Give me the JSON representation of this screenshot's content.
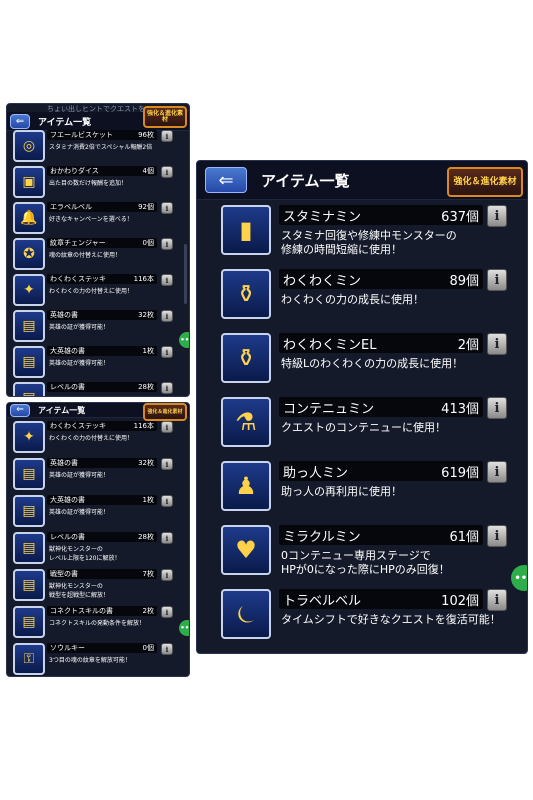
{
  "header": {
    "title": "アイテム一覧",
    "badge": "強化＆進化素材",
    "back_icon": "back-arrow-icon"
  },
  "top_left_overlay": "ちょい出しヒントでクエストを",
  "panel_a": {
    "items": [
      {
        "name": "フエールビスケット",
        "count": "96枚",
        "desc": "スタミナ消費2倍でスペシャル報酬2倍",
        "icon": "biscuit-icon"
      },
      {
        "name": "おかわりダイス",
        "count": "4個",
        "desc": "出た目の数だけ報酬を追加！",
        "icon": "dice-icon"
      },
      {
        "name": "エラベルベル",
        "count": "92個",
        "desc": "好きなキャンペーンを選べる！",
        "icon": "bell-icon"
      },
      {
        "name": "紋章チェンジャー",
        "count": "0個",
        "desc": "魂の紋章の付替えに使用！",
        "icon": "emblem-icon"
      },
      {
        "name": "わくわくステッキ",
        "count": "116本",
        "desc": "わくわくの力の付替えに使用！",
        "icon": "stick-icon"
      },
      {
        "name": "英雄の書",
        "count": "32枚",
        "desc": "英雄の証が獲得可能！",
        "icon": "book-icon"
      },
      {
        "name": "大英雄の書",
        "count": "1枚",
        "desc": "英雄の証が獲得可能！",
        "icon": "book-icon"
      },
      {
        "name": "レベルの書",
        "count": "28枚",
        "desc": "",
        "icon": "book-icon"
      }
    ]
  },
  "panel_b": {
    "items": [
      {
        "name": "わくわくステッキ",
        "count": "116本",
        "desc": "わくわくの力の付替えに使用！",
        "icon": "stick-icon"
      },
      {
        "name": "英雄の書",
        "count": "32枚",
        "desc": "英雄の証が獲得可能！",
        "icon": "book-icon"
      },
      {
        "name": "大英雄の書",
        "count": "1枚",
        "desc": "英雄の証が獲得可能！",
        "icon": "book-icon"
      },
      {
        "name": "レベルの書",
        "count": "28枚",
        "desc": "獣神化モンスターの|レベル上限を120に解放！",
        "icon": "book-icon"
      },
      {
        "name": "戦型の書",
        "count": "7枚",
        "desc": "獣神化モンスターの|戦型を超戦型に解放！",
        "icon": "book-icon"
      },
      {
        "name": "コネクトスキルの書",
        "count": "2枚",
        "desc": "コネクトスキルの発動条件を解放！",
        "icon": "book-icon"
      },
      {
        "name": "ソウルキー",
        "count": "0個",
        "desc": "3つ目の魂の紋章を解放可能！",
        "icon": "key-icon"
      }
    ]
  },
  "panel_c": {
    "items": [
      {
        "name": "スタミナミン",
        "count": "637個",
        "desc": "スタミナ回復や修練中モンスターの|修練の時間短縮に使用！",
        "icon": "stamina-can-icon"
      },
      {
        "name": "わくわくミン",
        "count": "89個",
        "desc": "わくわくの力の成長に使用！",
        "icon": "bottle-icon"
      },
      {
        "name": "わくわくミンEL",
        "count": "2個",
        "desc": "特級Lのわくわくの力の成長に使用！",
        "icon": "bottle-el-icon"
      },
      {
        "name": "コンテニュミン",
        "count": "413個",
        "desc": "クエストのコンテニューに使用！",
        "icon": "continue-potion-icon"
      },
      {
        "name": "助っ人ミン",
        "count": "619個",
        "desc": "助っ人の再利用に使用！",
        "icon": "helper-icon"
      },
      {
        "name": "ミラクルミン",
        "count": "61個",
        "desc": "0コンテニュー専用ステージで|HPが0になった際にHPのみ回復！",
        "icon": "miracle-potion-icon"
      },
      {
        "name": "トラベルベル",
        "count": "102個",
        "desc": "タイムシフトで好きなクエストを復活可能！",
        "icon": "travel-bell-icon"
      }
    ]
  },
  "fab_label": "•••",
  "info_label": "i",
  "colors": {
    "accent": "#2eae4a",
    "panel_bg": "#141a2a",
    "badge_border": "#d88a20"
  }
}
